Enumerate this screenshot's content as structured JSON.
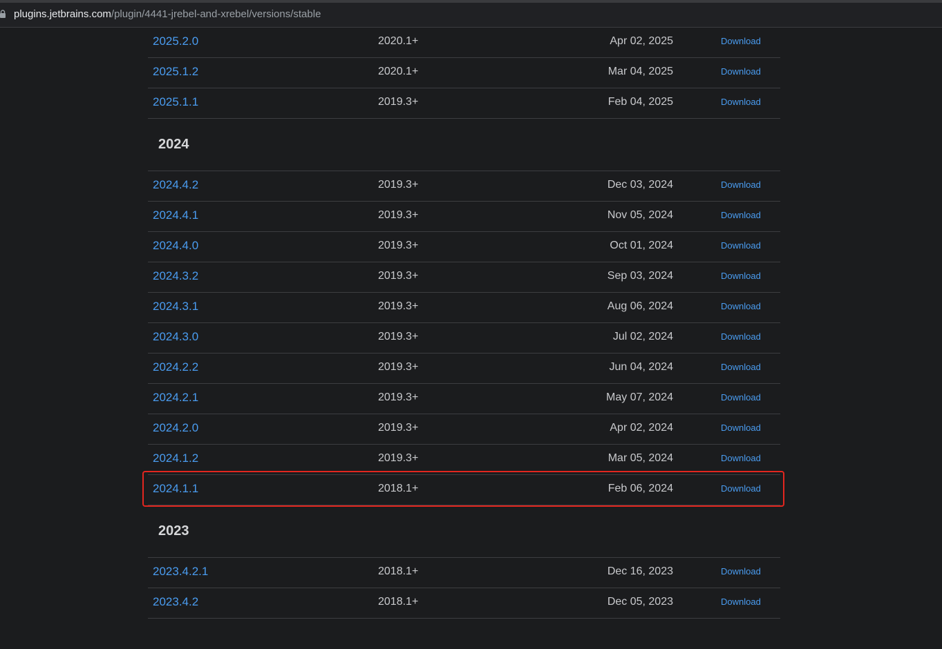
{
  "browser": {
    "url_host": "plugins.jetbrains.com",
    "url_path": "/plugin/4441-jrebel-and-xrebel/versions/stable"
  },
  "groups": [
    {
      "year": "",
      "rows": [
        {
          "version": "2025.2.0",
          "compat": "2020.1+",
          "date": "Apr 02, 2025",
          "action": "Download"
        },
        {
          "version": "2025.1.2",
          "compat": "2020.1+",
          "date": "Mar 04, 2025",
          "action": "Download"
        },
        {
          "version": "2025.1.1",
          "compat": "2019.3+",
          "date": "Feb 04, 2025",
          "action": "Download"
        }
      ]
    },
    {
      "year": "2024",
      "rows": [
        {
          "version": "2024.4.2",
          "compat": "2019.3+",
          "date": "Dec 03, 2024",
          "action": "Download"
        },
        {
          "version": "2024.4.1",
          "compat": "2019.3+",
          "date": "Nov 05, 2024",
          "action": "Download"
        },
        {
          "version": "2024.4.0",
          "compat": "2019.3+",
          "date": "Oct 01, 2024",
          "action": "Download"
        },
        {
          "version": "2024.3.2",
          "compat": "2019.3+",
          "date": "Sep 03, 2024",
          "action": "Download"
        },
        {
          "version": "2024.3.1",
          "compat": "2019.3+",
          "date": "Aug 06, 2024",
          "action": "Download"
        },
        {
          "version": "2024.3.0",
          "compat": "2019.3+",
          "date": "Jul 02, 2024",
          "action": "Download"
        },
        {
          "version": "2024.2.2",
          "compat": "2019.3+",
          "date": "Jun 04, 2024",
          "action": "Download"
        },
        {
          "version": "2024.2.1",
          "compat": "2019.3+",
          "date": "May 07, 2024",
          "action": "Download"
        },
        {
          "version": "2024.2.0",
          "compat": "2019.3+",
          "date": "Apr 02, 2024",
          "action": "Download"
        },
        {
          "version": "2024.1.2",
          "compat": "2019.3+",
          "date": "Mar 05, 2024",
          "action": "Download"
        },
        {
          "version": "2024.1.1",
          "compat": "2018.1+",
          "date": "Feb 06, 2024",
          "action": "Download",
          "highlighted": true
        }
      ]
    },
    {
      "year": "2023",
      "rows": [
        {
          "version": "2023.4.2.1",
          "compat": "2018.1+",
          "date": "Dec 16, 2023",
          "action": "Download"
        },
        {
          "version": "2023.4.2",
          "compat": "2018.1+",
          "date": "Dec 05, 2023",
          "action": "Download"
        }
      ]
    }
  ],
  "colors": {
    "background": "#1b1c1e",
    "link": "#4a9cf0",
    "highlight": "#e3261f"
  }
}
